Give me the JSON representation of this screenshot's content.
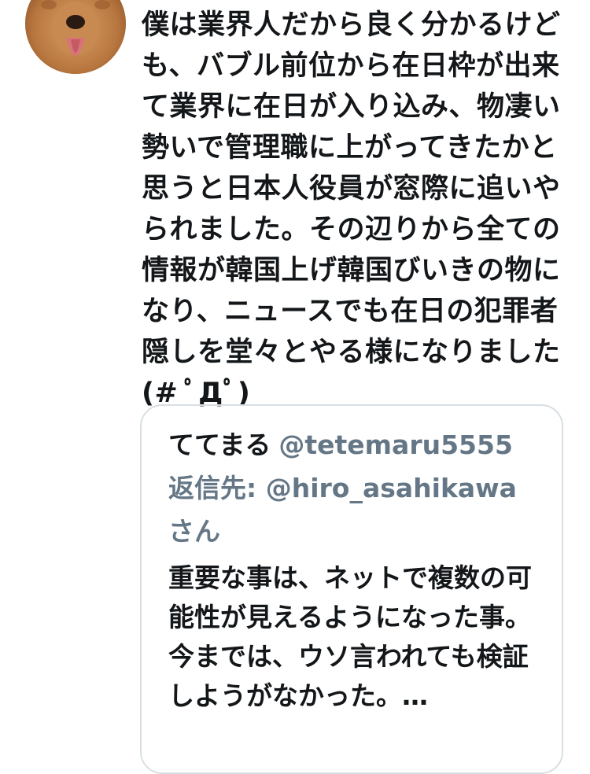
{
  "tweet": {
    "text": "僕は業界人だから良く分かるけども、バブル前位から在日枠が出来て業界に在日が入り込み、物凄い勢いで管理職に上がってきたかと思うと日本人役員が窓際に追いやられました。その辺りから全ての情報が韓国上げ韓国びいきの物になり、ニュースでも在日の犯罪者隠しを堂々とやる様になりました(# ﾟДﾟ)"
  },
  "quote": {
    "display_name": "ててまる",
    "handle": "@tetemaru5555",
    "reply_prefix": "返信先:",
    "reply_to": "@hiro_asahikawa",
    "reply_suffix": "さん",
    "text": "重要な事は、ネットで複数の可能性が見えるようになった事。\n今までは、ウソ言われても検証しようがなかった。…"
  },
  "colors": {
    "text_primary": "#14171a",
    "text_secondary": "#657786",
    "card_border": "#d8dfe4"
  },
  "icons": {
    "avatar": "dog-avatar"
  }
}
